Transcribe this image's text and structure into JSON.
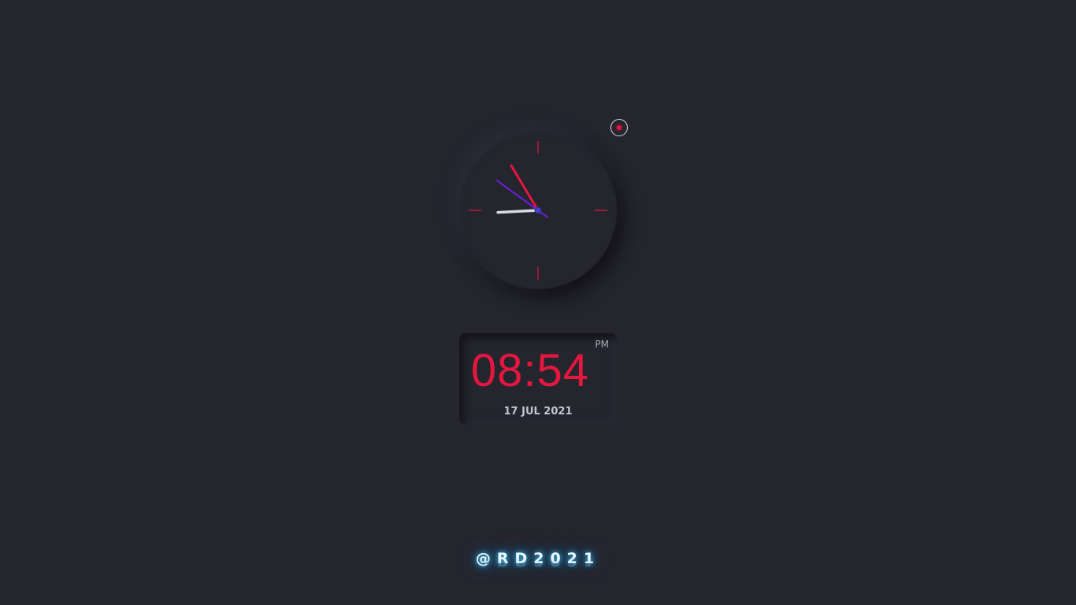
{
  "digital": {
    "time": "08:54",
    "ampm": "PM",
    "date": "17 JUL 2021"
  },
  "signature": "@RD2021",
  "analog": {
    "hour": 8,
    "minute": 54,
    "second": 51
  },
  "colors": {
    "background": "#25252e",
    "accent": "#e5163f",
    "minute_hand": "#e5163f",
    "second_hand": "#6a1fe0",
    "hour_hand": "#d9d9e2",
    "signature_glow": "#3fb5e8"
  },
  "icons": {
    "theme_toggle": "sun-icon"
  }
}
